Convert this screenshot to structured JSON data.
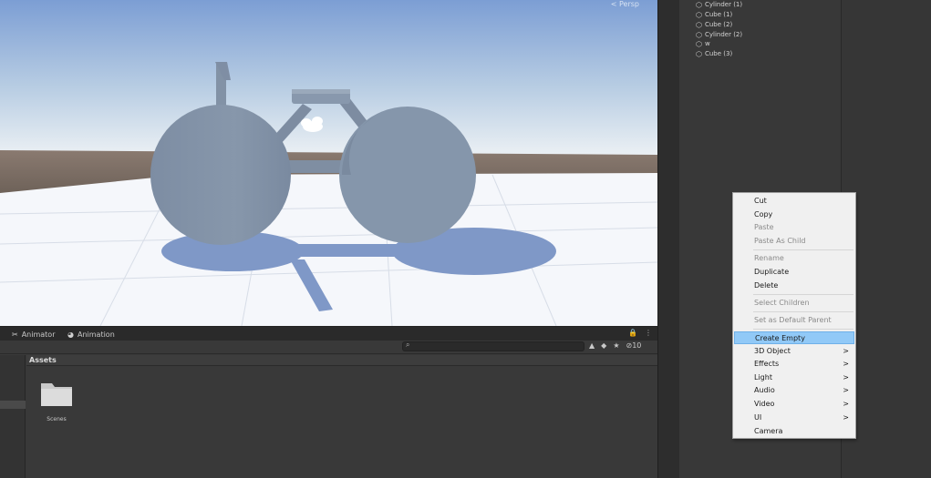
{
  "scene": {
    "view_label": "< Persp"
  },
  "bottom_panel": {
    "tabs": [
      {
        "icon": "animator-icon",
        "glyph": "✂",
        "label": "Animator"
      },
      {
        "icon": "animation-icon",
        "glyph": "◕",
        "label": "Animation"
      }
    ],
    "tab_controls": {
      "lock": "🔒",
      "more": "⋮"
    },
    "toolbar": {
      "hidden_count": "10"
    },
    "assets_header": "Assets",
    "folders": [
      {
        "label": "Scenes"
      }
    ]
  },
  "hierarchy": {
    "items": [
      {
        "label": "Cylinder (1)"
      },
      {
        "label": "Cube (1)"
      },
      {
        "label": "Cube (2)"
      },
      {
        "label": "Cylinder (2)"
      },
      {
        "label": "w"
      },
      {
        "label": "Cube (3)"
      }
    ]
  },
  "context_menu": {
    "items": [
      {
        "label": "Cut",
        "disabled": false
      },
      {
        "label": "Copy",
        "disabled": false
      },
      {
        "label": "Paste",
        "disabled": true
      },
      {
        "label": "Paste As Child",
        "disabled": true
      },
      {
        "label": "Rename",
        "disabled": true
      },
      {
        "label": "Duplicate",
        "disabled": false
      },
      {
        "label": "Delete",
        "disabled": false
      },
      {
        "label": "Select Children",
        "disabled": true
      },
      {
        "label": "Set as Default Parent",
        "disabled": true
      },
      {
        "label": "Create Empty",
        "disabled": false,
        "highlighted": true
      },
      {
        "label": "3D Object",
        "disabled": false,
        "submenu": true
      },
      {
        "label": "Effects",
        "disabled": false,
        "submenu": true
      },
      {
        "label": "Light",
        "disabled": false,
        "submenu": true
      },
      {
        "label": "Audio",
        "disabled": false,
        "submenu": true
      },
      {
        "label": "Video",
        "disabled": false,
        "submenu": true
      },
      {
        "label": "UI",
        "disabled": false,
        "submenu": true
      },
      {
        "label": "Camera",
        "disabled": false
      }
    ],
    "submenu_arrow": ">"
  },
  "colors": {
    "sky_top": "#7d9fd4",
    "sky_horizon": "#e9eef3",
    "ground": "#f4f6fa",
    "model": "#8292a6",
    "shadow": "#7e97c6",
    "menu_highlight": "#91c9f7"
  }
}
